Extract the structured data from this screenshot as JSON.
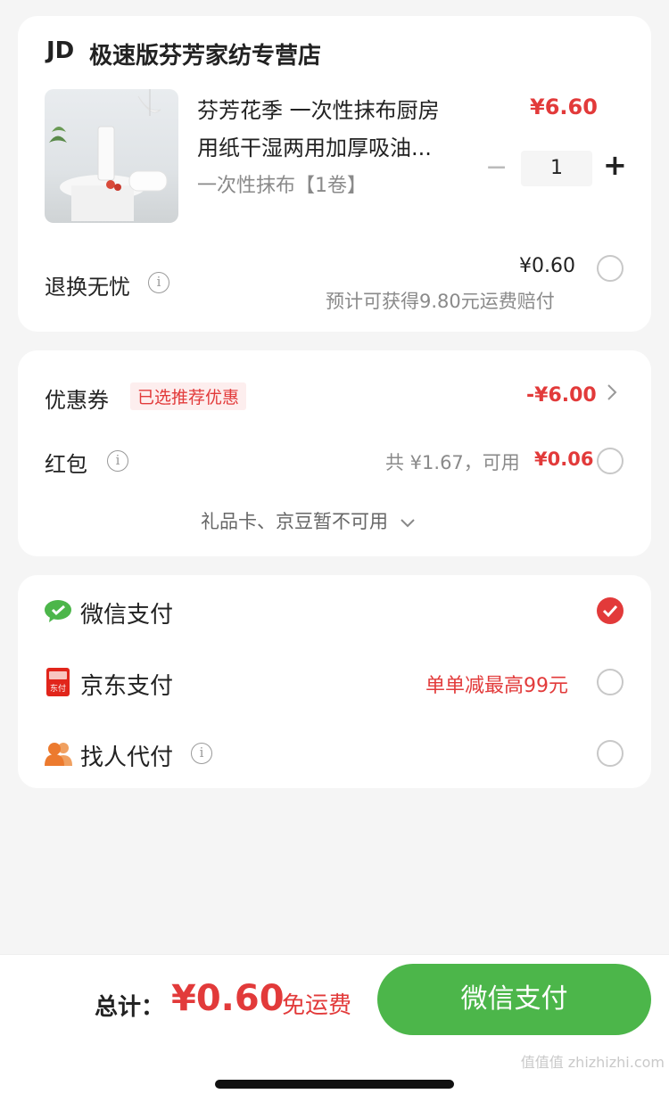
{
  "store": {
    "logo": "JD",
    "name": "极速版芬芳家纺专营店"
  },
  "product": {
    "title_line1": "芬芳花季 一次性抹布厨房",
    "title_line2": "用纸干湿两用加厚吸油...",
    "spec": "一次性抹布【1卷】",
    "price": "¥6.60",
    "quantity": "1",
    "minus": "−",
    "plus": "+"
  },
  "return_service": {
    "label": "退换无忧",
    "price": "¥0.60",
    "note": "预计可获得9.80元运费赔付"
  },
  "coupon": {
    "label": "优惠券",
    "badge": "已选推荐优惠",
    "value": "-¥6.00"
  },
  "redpacket": {
    "label": "红包",
    "total": "共 ¥1.67，可用",
    "usable": "¥0.06"
  },
  "giftcard": {
    "text": "礼品卡、京豆暂不可用"
  },
  "payment": {
    "options": [
      {
        "label": "微信支付",
        "icon": "wechat-pay-icon",
        "promo": "",
        "selected": true
      },
      {
        "label": "京东支付",
        "icon": "jd-pay-icon",
        "promo": "单单减最高99元",
        "selected": false
      },
      {
        "label": "找人代付",
        "icon": "friends-pay-icon",
        "promo": "",
        "selected": false
      }
    ],
    "jd_icon_text": "东付"
  },
  "footer": {
    "total_label": "总计：",
    "total_value": "¥0.60",
    "shipping": "免运费",
    "pay_button": "微信支付"
  },
  "watermark": "值值值 zhizhizhi.com",
  "colors": {
    "accent": "#e23a3a",
    "wechat_green": "#4cb64a",
    "jd_red": "#e1251b"
  }
}
